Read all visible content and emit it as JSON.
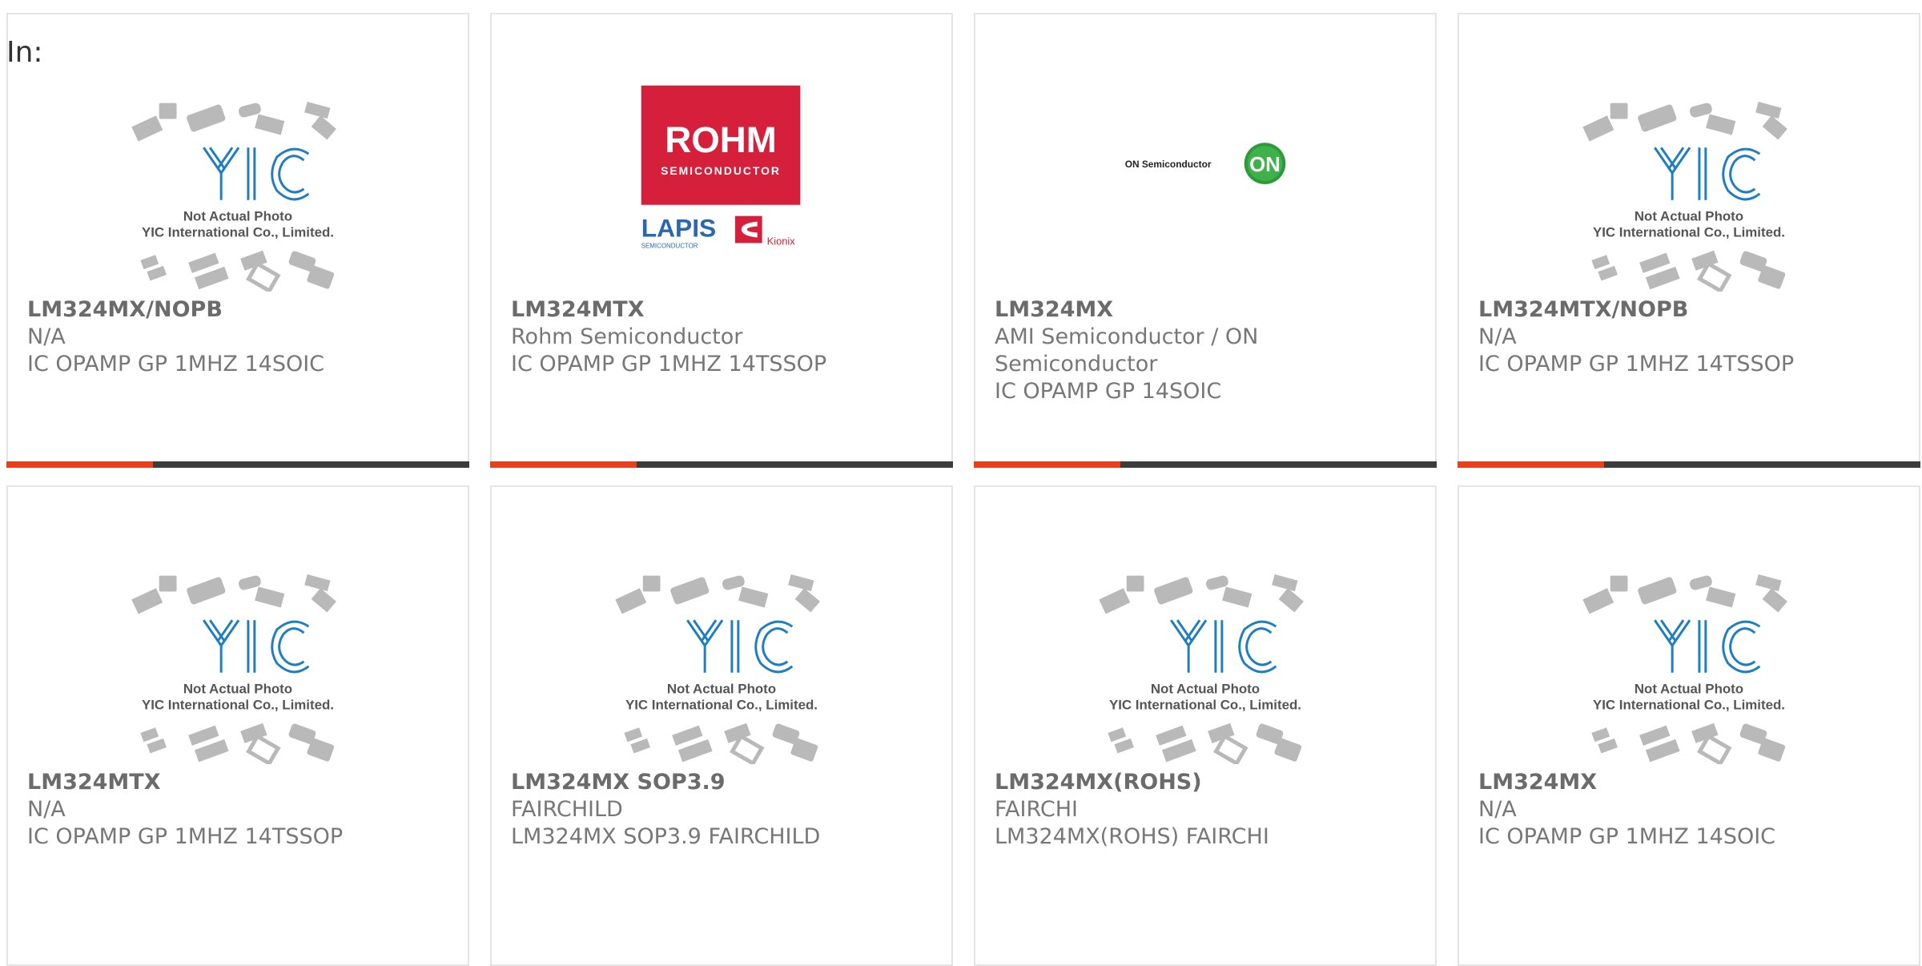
{
  "page": {
    "prefix_label": "In:"
  },
  "placeholder": {
    "line1": "Not Actual Photo",
    "line2": "YIC International Co., Limited."
  },
  "logos": {
    "rohm_main": "ROHM",
    "rohm_sub": "SEMICONDUCTOR",
    "lapis_main": "LAPIS",
    "lapis_sub": "SEMICONDUCTOR",
    "kionix": "Kionix",
    "on_text": "ON Semiconductor",
    "on_badge": "ON"
  },
  "colors": {
    "accent_orange": "#e8401c",
    "accent_dark": "#3c3c3c",
    "rohm_red": "#d6203b",
    "on_green": "#2d9a3a"
  },
  "products": [
    {
      "part": "LM324MX/NOPB",
      "manufacturer": "N/A",
      "description": "IC OPAMP GP 1MHZ 14SOIC",
      "image": "placeholder"
    },
    {
      "part": "LM324MTX",
      "manufacturer": "Rohm Semiconductor",
      "description": "IC OPAMP GP 1MHZ 14TSSOP",
      "image": "rohm-logo"
    },
    {
      "part": "LM324MX",
      "manufacturer": "AMI Semiconductor / ON Semiconductor",
      "description": "IC OPAMP GP 14SOIC",
      "image": "on-semi-logo"
    },
    {
      "part": "LM324MTX/NOPB",
      "manufacturer": "N/A",
      "description": "IC OPAMP GP 1MHZ 14TSSOP",
      "image": "placeholder"
    },
    {
      "part": "LM324MTX",
      "manufacturer": "N/A",
      "description": "IC OPAMP GP 1MHZ 14TSSOP",
      "image": "placeholder"
    },
    {
      "part": "LM324MX SOP3.9",
      "manufacturer": "FAIRCHILD",
      "description": "LM324MX SOP3.9 FAIRCHILD",
      "image": "placeholder"
    },
    {
      "part": "LM324MX(ROHS)",
      "manufacturer": "FAIRCHI",
      "description": "LM324MX(ROHS) FAIRCHI",
      "image": "placeholder"
    },
    {
      "part": "LM324MX",
      "manufacturer": "N/A",
      "description": "IC OPAMP GP 1MHZ 14SOIC",
      "image": "placeholder"
    }
  ]
}
